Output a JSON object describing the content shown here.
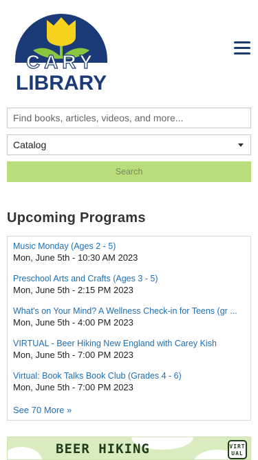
{
  "header": {
    "logo_alt": "CARY LIBRARY",
    "logo_line1": "CARY",
    "logo_line2": "LIBRARY",
    "menu_icon": "hamburger-menu-icon"
  },
  "search": {
    "placeholder": "Find books, articles, videos, and more...",
    "scope_selected": "Catalog",
    "button_label": "Search"
  },
  "programs": {
    "title": "Upcoming Programs",
    "items": [
      {
        "title": "Music Monday (Ages 2 - 5)",
        "date": "Mon, June 5th - 10:30 AM 2023"
      },
      {
        "title": "Preschool Arts and Crafts (Ages 3 - 5)",
        "date": "Mon, June 5th - 2:15 PM 2023"
      },
      {
        "title": "What's on Your Mind? A Wellness Check-in for Teens (gr ...",
        "date": "Mon, June 5th - 4:00 PM 2023"
      },
      {
        "title": "VIRTUAL - Beer Hiking New England with Carey Kish",
        "date": "Mon, June 5th - 7:00 PM 2023"
      },
      {
        "title": "Virtual: Book Talks Book Club (Grades 4 - 6)",
        "date": "Mon, June 5th - 7:00 PM 2023"
      }
    ],
    "see_more": "See 70 More »"
  },
  "banner": {
    "text": "BEER HIKING",
    "badge_line1": "VIRT",
    "badge_line2": "UAL"
  },
  "colors": {
    "brand_navy": "#1b3a78",
    "link_blue": "#1f6fb3",
    "search_green": "#b8dd7a",
    "tulip_yellow": "#f5d21c",
    "leaf_green": "#8cc63f"
  }
}
